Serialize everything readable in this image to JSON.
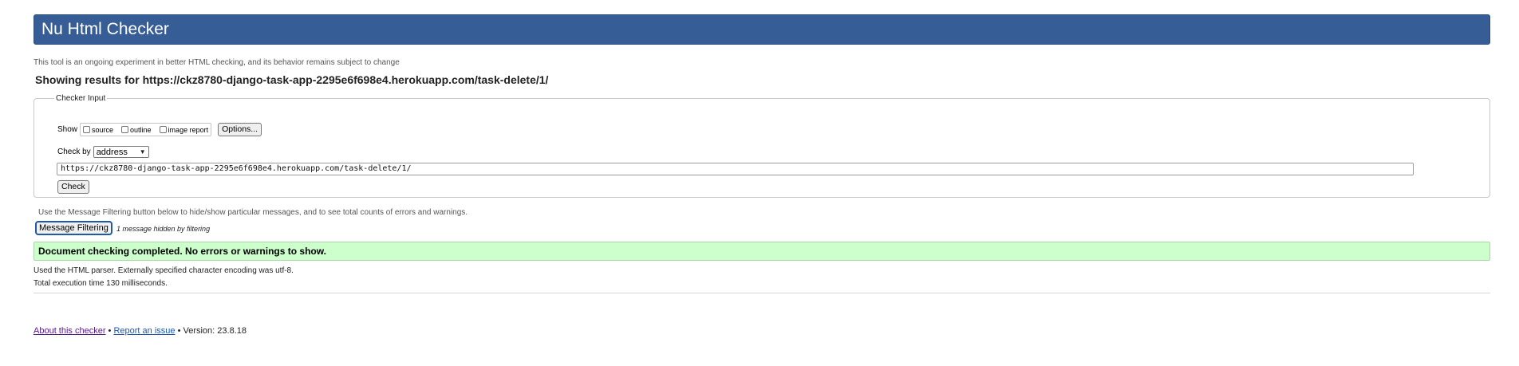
{
  "header": {
    "title": "Nu Html Checker"
  },
  "tagline": "This tool is an ongoing experiment in better HTML checking, and its behavior remains subject to change",
  "results": {
    "prefix": "Showing results for ",
    "url": "https://ckz8780-django-task-app-2295e6f698e4.herokuapp.com/task-delete/1/"
  },
  "checker_input": {
    "legend": "Checker Input",
    "show_label": "Show",
    "show_options": [
      {
        "label": "source",
        "checked": false
      },
      {
        "label": "outline",
        "checked": false
      },
      {
        "label": "image report",
        "checked": false
      }
    ],
    "options_button": "Options...",
    "check_by_label": "Check by",
    "check_by_value": "address",
    "url_value": "https://ckz8780-django-task-app-2295e6f698e4.herokuapp.com/task-delete/1/",
    "check_button": "Check"
  },
  "filtering": {
    "note": "Use the Message Filtering button below to hide/show particular messages, and to see total counts of errors and warnings.",
    "button": "Message Filtering",
    "hidden_note": "1 message hidden by filtering"
  },
  "success_message": "Document checking completed. No errors or warnings to show.",
  "info": {
    "parser": "Used the HTML parser. Externally specified character encoding was utf-8.",
    "time": "Total execution time 130 milliseconds."
  },
  "footer": {
    "about_link": "About this checker",
    "sep1": " • ",
    "report_link": "Report an issue",
    "version": " • Version: 23.8.18"
  },
  "colors": {
    "header_bg": "#365d95",
    "success_bg": "#ccffcc"
  }
}
